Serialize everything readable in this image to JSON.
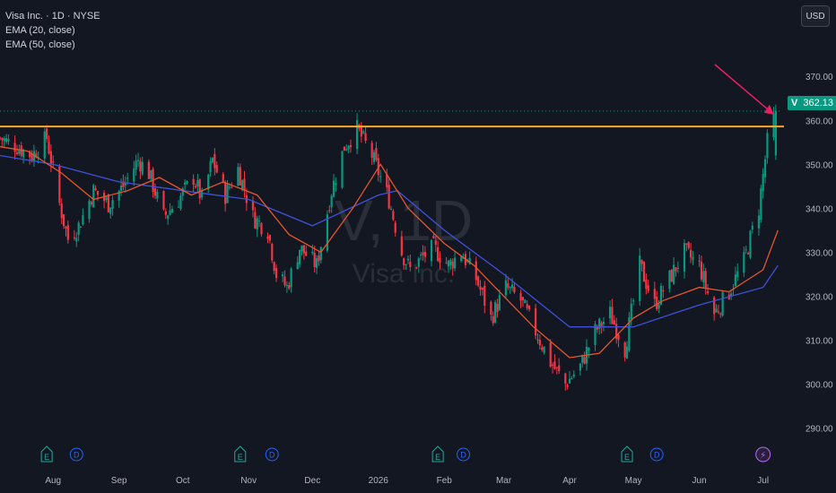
{
  "legend": {
    "title": "Visa Inc. · 1D · NYSE",
    "ema20": "EMA (20, close)",
    "ema50": "EMA (50, close)"
  },
  "currency": "USD",
  "watermark": {
    "ticker": "V, 1D",
    "name": "Visa Inc."
  },
  "price_badge": {
    "symbol": "V",
    "value": "362.13"
  },
  "colors": {
    "background": "#131722",
    "up": "#089981",
    "down": "#f23645",
    "ema20": "#e4572e",
    "ema50": "#3f51d9",
    "resistance": "#ffa726",
    "arrow": "#e91e63",
    "event_earnings": "#26a69a",
    "event_dividend": "#2962ff",
    "event_split": "#b36cf0"
  },
  "events": [
    {
      "type": "earnings",
      "label": "E",
      "date": "2025-07-29"
    },
    {
      "type": "dividend",
      "label": "D",
      "date": "2025-08-12"
    },
    {
      "type": "earnings",
      "label": "E",
      "date": "2025-10-28"
    },
    {
      "type": "dividend",
      "label": "D",
      "date": "2025-11-12"
    },
    {
      "type": "earnings",
      "label": "E",
      "date": "2026-01-29"
    },
    {
      "type": "dividend",
      "label": "D",
      "date": "2026-02-10"
    },
    {
      "type": "earnings",
      "label": "E",
      "date": "2026-04-28"
    },
    {
      "type": "dividend",
      "label": "D",
      "date": "2026-05-12"
    },
    {
      "type": "split",
      "label": "⚡",
      "date": "2026-07-01"
    }
  ],
  "chart_data": {
    "type": "candlestick",
    "y_axis": {
      "range": [
        285,
        378
      ],
      "ticks": [
        290,
        300,
        310,
        320,
        330,
        340,
        350,
        360,
        370
      ],
      "tick_labels": [
        "290.00",
        "300.00",
        "310.00",
        "320.00",
        "330.00",
        "340.00",
        "350.00",
        "360.00",
        "370.00"
      ],
      "position": "right"
    },
    "x_axis": {
      "range": [
        "2025-07-07",
        "2026-07-10"
      ],
      "labels": [
        {
          "text": "Aug",
          "date": "2025-08-01"
        },
        {
          "text": "Sep",
          "date": "2025-09-01"
        },
        {
          "text": "Oct",
          "date": "2025-10-01"
        },
        {
          "text": "Nov",
          "date": "2025-11-01"
        },
        {
          "text": "Dec",
          "date": "2025-12-01"
        },
        {
          "text": "2026",
          "date": "2026-01-01"
        },
        {
          "text": "Feb",
          "date": "2026-02-01"
        },
        {
          "text": "Mar",
          "date": "2026-03-01"
        },
        {
          "text": "Apr",
          "date": "2026-04-01"
        },
        {
          "text": "May",
          "date": "2026-05-01"
        },
        {
          "text": "Jun",
          "date": "2026-06-01"
        },
        {
          "text": "Jul",
          "date": "2026-07-01"
        }
      ]
    },
    "grid": false,
    "last_price": 362.13,
    "resistance_level": 358.6,
    "series": [
      {
        "name": "close",
        "points": [
          [
            "2025-07-07",
            356
          ],
          [
            "2025-07-15",
            354
          ],
          [
            "2025-07-22",
            352
          ],
          [
            "2025-07-29",
            356
          ],
          [
            "2025-08-04",
            341
          ],
          [
            "2025-08-08",
            333
          ],
          [
            "2025-08-13",
            336
          ],
          [
            "2025-08-20",
            344
          ],
          [
            "2025-08-27",
            341
          ],
          [
            "2025-09-03",
            345
          ],
          [
            "2025-09-10",
            351
          ],
          [
            "2025-09-15",
            348
          ],
          [
            "2025-09-22",
            338
          ],
          [
            "2025-09-29",
            342
          ],
          [
            "2025-10-06",
            347
          ],
          [
            "2025-10-10",
            342
          ],
          [
            "2025-10-15",
            351
          ],
          [
            "2025-10-21",
            343
          ],
          [
            "2025-10-27",
            349
          ],
          [
            "2025-11-03",
            338
          ],
          [
            "2025-11-10",
            335
          ],
          [
            "2025-11-14",
            325
          ],
          [
            "2025-11-19",
            322
          ],
          [
            "2025-11-25",
            331
          ],
          [
            "2025-12-03",
            327
          ],
          [
            "2025-12-10",
            344
          ],
          [
            "2025-12-16",
            354
          ],
          [
            "2025-12-22",
            358
          ],
          [
            "2025-12-29",
            352
          ],
          [
            "2026-01-06",
            342
          ],
          [
            "2026-01-12",
            330
          ],
          [
            "2026-01-16",
            326
          ],
          [
            "2026-01-22",
            329
          ],
          [
            "2026-01-27",
            331
          ],
          [
            "2026-02-03",
            327
          ],
          [
            "2026-02-09",
            330
          ],
          [
            "2026-02-16",
            324
          ],
          [
            "2026-02-23",
            315
          ],
          [
            "2026-03-02",
            322
          ],
          [
            "2026-03-09",
            319
          ],
          [
            "2026-03-16",
            312
          ],
          [
            "2026-03-23",
            305
          ],
          [
            "2026-03-30",
            300
          ],
          [
            "2026-04-06",
            304
          ],
          [
            "2026-04-13",
            312
          ],
          [
            "2026-04-20",
            316
          ],
          [
            "2026-04-27",
            308
          ],
          [
            "2026-05-04",
            327
          ],
          [
            "2026-05-11",
            318
          ],
          [
            "2026-05-18",
            324
          ],
          [
            "2026-05-25",
            330
          ],
          [
            "2026-06-01",
            327
          ],
          [
            "2026-06-08",
            316
          ],
          [
            "2026-06-15",
            321
          ],
          [
            "2026-06-22",
            328
          ],
          [
            "2026-06-29",
            340
          ],
          [
            "2026-07-03",
            355
          ],
          [
            "2026-07-07",
            362.13
          ]
        ]
      },
      {
        "name": "EMA (20, close)",
        "points": [
          [
            "2025-07-07",
            354
          ],
          [
            "2025-07-20",
            353
          ],
          [
            "2025-08-05",
            348
          ],
          [
            "2025-08-20",
            342
          ],
          [
            "2025-09-05",
            344
          ],
          [
            "2025-09-20",
            347
          ],
          [
            "2025-10-05",
            343
          ],
          [
            "2025-10-20",
            346
          ],
          [
            "2025-11-05",
            343
          ],
          [
            "2025-11-20",
            334
          ],
          [
            "2025-12-05",
            330
          ],
          [
            "2025-12-20",
            340
          ],
          [
            "2026-01-02",
            350
          ],
          [
            "2026-01-15",
            340
          ],
          [
            "2026-02-01",
            332
          ],
          [
            "2026-02-15",
            327
          ],
          [
            "2026-03-01",
            320
          ],
          [
            "2026-03-15",
            313
          ],
          [
            "2026-04-01",
            306
          ],
          [
            "2026-04-15",
            307
          ],
          [
            "2026-05-01",
            315
          ],
          [
            "2026-05-15",
            319
          ],
          [
            "2026-06-01",
            322
          ],
          [
            "2026-06-15",
            321
          ],
          [
            "2026-07-01",
            326
          ],
          [
            "2026-07-08",
            335
          ]
        ]
      },
      {
        "name": "EMA (50, close)",
        "points": [
          [
            "2025-07-07",
            352
          ],
          [
            "2025-08-01",
            350
          ],
          [
            "2025-09-01",
            346
          ],
          [
            "2025-10-01",
            344
          ],
          [
            "2025-11-01",
            342
          ],
          [
            "2025-12-01",
            336
          ],
          [
            "2026-01-01",
            343
          ],
          [
            "2026-01-10",
            344
          ],
          [
            "2026-02-01",
            335
          ],
          [
            "2026-03-01",
            325
          ],
          [
            "2026-04-01",
            313
          ],
          [
            "2026-05-01",
            313
          ],
          [
            "2026-06-01",
            318
          ],
          [
            "2026-07-01",
            322
          ],
          [
            "2026-07-08",
            327
          ]
        ]
      }
    ]
  }
}
